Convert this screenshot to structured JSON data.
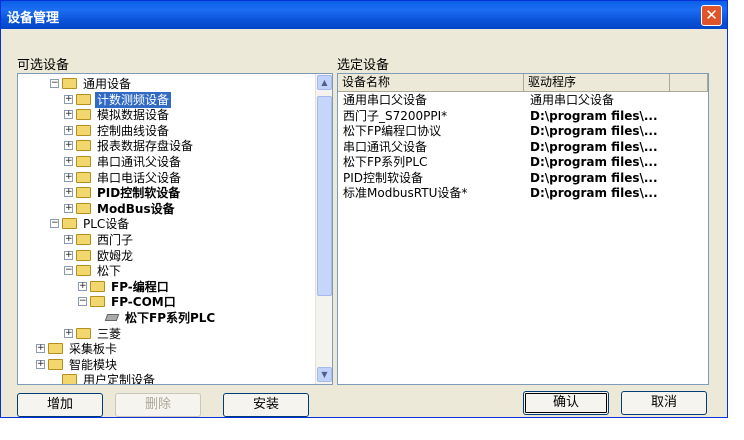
{
  "window": {
    "title": "设备管理"
  },
  "left_label": "可选设备",
  "right_label": "选定设备",
  "tree": [
    {
      "label": "通用设备",
      "exp": "−",
      "kind": "folder",
      "bold": false,
      "selected": false
    },
    {
      "label": "计数测频设备",
      "exp": "+",
      "kind": "folder",
      "bold": false,
      "selected": true
    },
    {
      "label": "模拟数据设备",
      "exp": "+",
      "kind": "folder",
      "bold": false,
      "selected": false
    },
    {
      "label": "控制曲线设备",
      "exp": "+",
      "kind": "folder",
      "bold": false,
      "selected": false
    },
    {
      "label": "报表数据存盘设备",
      "exp": "+",
      "kind": "folder",
      "bold": false,
      "selected": false
    },
    {
      "label": "串口通讯父设备",
      "exp": "+",
      "kind": "folder",
      "bold": false,
      "selected": false
    },
    {
      "label": "串口电话父设备",
      "exp": "+",
      "kind": "folder",
      "bold": false,
      "selected": false
    },
    {
      "label": "PID控制软设备",
      "exp": "+",
      "kind": "folder",
      "bold": true,
      "selected": false
    },
    {
      "label": "ModBus设备",
      "exp": "+",
      "kind": "folder",
      "bold": true,
      "selected": false
    },
    {
      "label": "PLC设备",
      "exp": "−",
      "kind": "folder",
      "bold": false,
      "selected": false
    },
    {
      "label": "西门子",
      "exp": "+",
      "kind": "folder",
      "bold": false,
      "selected": false
    },
    {
      "label": "欧姆龙",
      "exp": "+",
      "kind": "folder",
      "bold": false,
      "selected": false
    },
    {
      "label": "松下",
      "exp": "−",
      "kind": "folder",
      "bold": false,
      "selected": false
    },
    {
      "label": "FP-编程口",
      "exp": "+",
      "kind": "folder",
      "bold": true,
      "selected": false
    },
    {
      "label": "FP-COM口",
      "exp": "−",
      "kind": "folder",
      "bold": true,
      "selected": false
    },
    {
      "label": "松下FP系列PLC",
      "exp": "",
      "kind": "leaf",
      "bold": true,
      "selected": false
    },
    {
      "label": "三菱",
      "exp": "+",
      "kind": "folder",
      "bold": false,
      "selected": false
    },
    {
      "label": "采集板卡",
      "exp": "+",
      "kind": "folder",
      "bold": false,
      "selected": false
    },
    {
      "label": "智能模块",
      "exp": "+",
      "kind": "folder",
      "bold": false,
      "selected": false
    },
    {
      "label": "用户定制设备",
      "exp": "",
      "kind": "folder",
      "bold": false,
      "selected": false
    }
  ],
  "columns": [
    "设备名称",
    "驱动程序"
  ],
  "rows": [
    {
      "name": "通用串口父设备",
      "driver": "通用串口父设备"
    },
    {
      "name": "西门子_S7200PPI*",
      "driver": "D:\\program files\\..."
    },
    {
      "name": "松下FP编程口协议",
      "driver": "D:\\program files\\..."
    },
    {
      "name": "串口通讯父设备",
      "driver": "D:\\program files\\..."
    },
    {
      "name": "松下FP系列PLC",
      "driver": "D:\\program files\\..."
    },
    {
      "name": "PID控制软设备",
      "driver": "D:\\program files\\..."
    },
    {
      "name": "标准ModbusRTU设备*",
      "driver": "D:\\program files\\..."
    }
  ],
  "buttons": {
    "add": "增加",
    "delete": "删除",
    "install": "安装",
    "ok": "确认",
    "cancel": "取消"
  },
  "icons": {
    "close": "close-icon",
    "folder": "folder-icon",
    "leaf": "device-icon",
    "scroll_up": "arrow-up-icon",
    "scroll_down": "arrow-down-icon"
  },
  "colors": {
    "titlebar": "#0a5fe6",
    "selection": "#316ac5",
    "dialog": "#ece9d8"
  }
}
